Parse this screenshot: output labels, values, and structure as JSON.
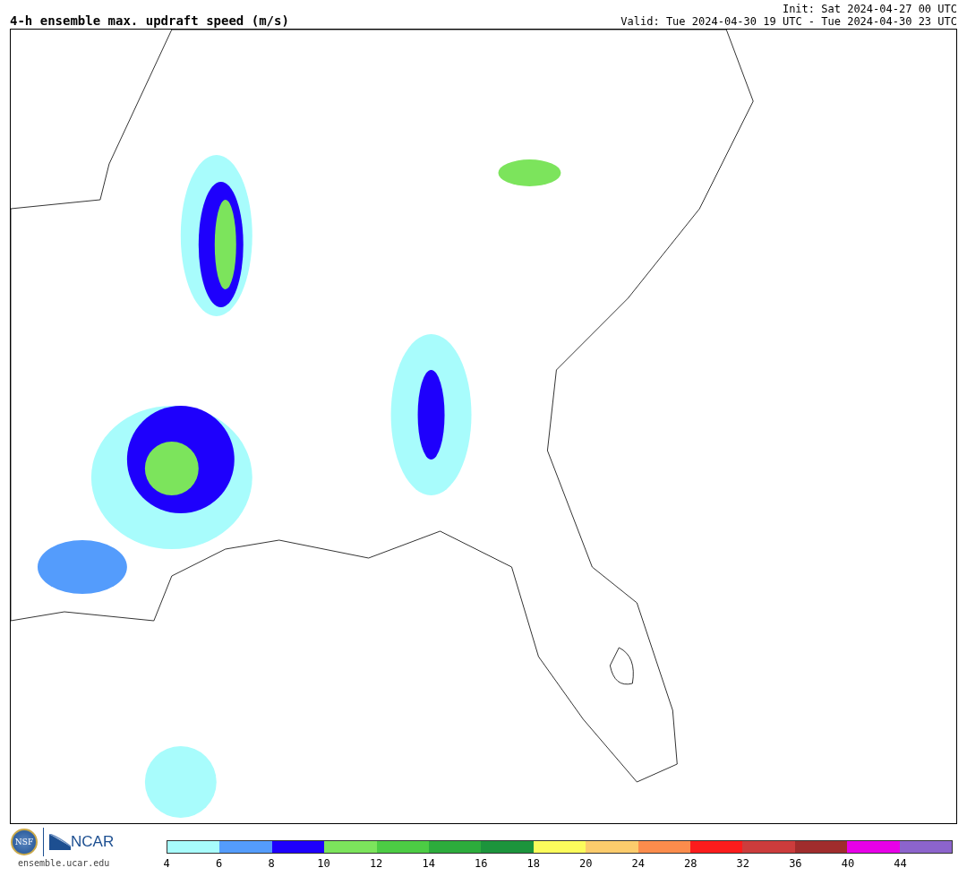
{
  "title": "4-h ensemble max. updraft speed (m/s)",
  "init": "Init: Sat 2024-04-27 00 UTC",
  "valid": "Valid: Tue 2024-04-30 19 UTC - Tue 2024-04-30 23 UTC",
  "logos": {
    "nsf": "NSF",
    "ncar": "NCAR",
    "url": "ensemble.ucar.edu"
  },
  "legend": [
    {
      "color": "#a8fcfc",
      "label": "4"
    },
    {
      "color": "#549cfc",
      "label": "6"
    },
    {
      "color": "#1e00fc",
      "label": "8"
    },
    {
      "color": "#7ce45c",
      "label": "10"
    },
    {
      "color": "#4ccc44",
      "label": "12"
    },
    {
      "color": "#2cac3c",
      "label": "14"
    },
    {
      "color": "#1c943c",
      "label": "16"
    },
    {
      "color": "#fcfc5c",
      "label": "18"
    },
    {
      "color": "#fccc6c",
      "label": "20"
    },
    {
      "color": "#fc8c4c",
      "label": "24"
    },
    {
      "color": "#fc1c1c",
      "label": "28"
    },
    {
      "color": "#cc3c3c",
      "label": "32"
    },
    {
      "color": "#a02c2c",
      "label": "36"
    },
    {
      "color": "#e800e8",
      "label": "40"
    },
    {
      "color": "#8c64cc",
      "label": "44"
    }
  ]
}
